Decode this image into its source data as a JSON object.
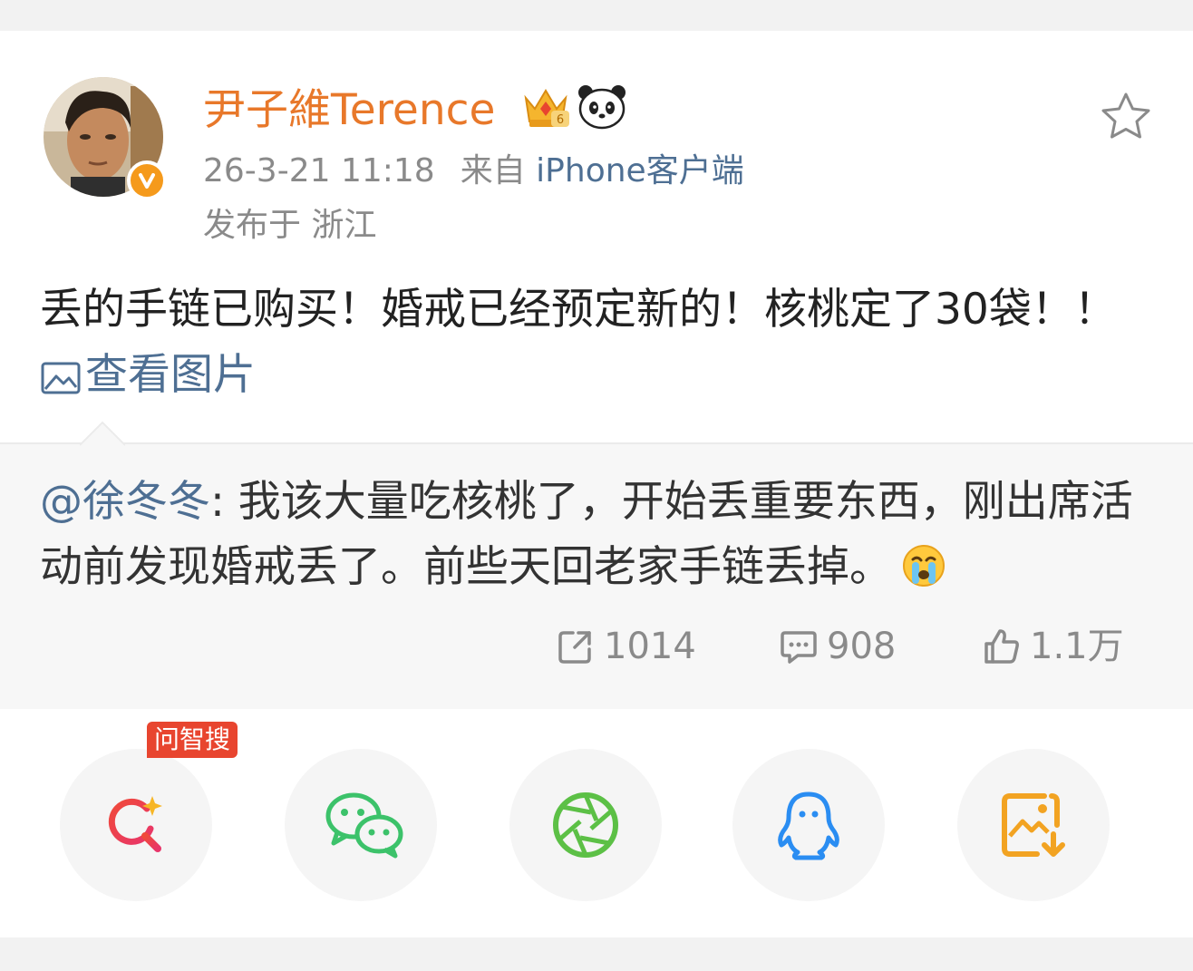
{
  "post": {
    "author": {
      "name": "尹子維Terence",
      "icons": [
        "crown-icon",
        "panda-icon",
        "verified-badge-icon"
      ]
    },
    "timestamp": "26-3-21 11:18",
    "source_prefix": "来自",
    "source": "iPhone客户端",
    "location": "发布于 浙江",
    "text": "丢的手链已购买！婚戒已经预定新的！核桃定了30袋！！",
    "view_pictures_label": "查看图片"
  },
  "repost": {
    "mention": "@徐冬冬",
    "text": ": 我该大量吃核桃了，开始丢重要东西，刚出席活动前发现婚戒丢了。前些天回老家手链丢掉。",
    "stats": {
      "reposts": "1014",
      "comments": "908",
      "likes": "1.1万"
    }
  },
  "share": {
    "badge": "问智搜",
    "items": [
      "search-ai-icon",
      "wechat-icon",
      "moments-icon",
      "qq-icon",
      "save-image-icon"
    ]
  },
  "colors": {
    "username": "#e8782a",
    "link": "#4e6f93",
    "meta": "#8a8a8a",
    "body_text": "#222222",
    "badge": "#e8452f"
  }
}
